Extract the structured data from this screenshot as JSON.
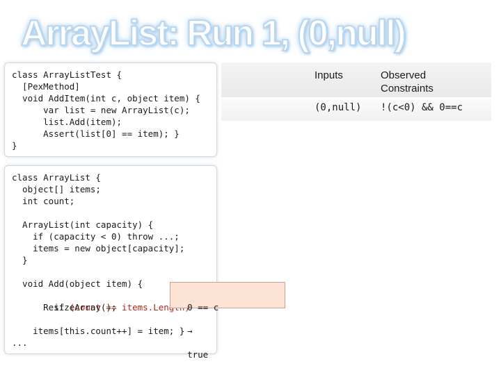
{
  "title": "ArrayList: Run 1, (0,null)",
  "test_code": [
    "class ArrayListTest {",
    "  [PexMethod]",
    "  void AddItem(int c, object item) {",
    "      var list = new ArrayList(c);",
    "      list.Add(item);",
    "      Assert(list[0] == item); }",
    "}"
  ],
  "impl_code": {
    "lines_top": [
      "class ArrayList {",
      "  object[] items;",
      "  int count;",
      "",
      "  ArrayList(int capacity) {",
      "    if (capacity < 0) throw ...;",
      "    items = new object[capacity];",
      "  }",
      "",
      "  void Add(object item) {"
    ],
    "highlight_line": {
      "prefix": "    if ",
      "condition": "(count == items.Length)",
      "constraint": "0 == c",
      "arrow": "→",
      "result": "true"
    },
    "lines_bottom": [
      "      ResizeArray();",
      "",
      "    items[this.count++] = item; }",
      "..."
    ]
  },
  "table": {
    "headers": [
      "Inputs",
      "Observed Constraints"
    ],
    "rows": [
      [
        "(0,null)",
        "!(c<0) && 0==c"
      ]
    ]
  },
  "colors": {
    "title_glow": "#9cc6ea",
    "highlight_text": "#b5261e",
    "highlight_fill": "#fce3d6"
  }
}
